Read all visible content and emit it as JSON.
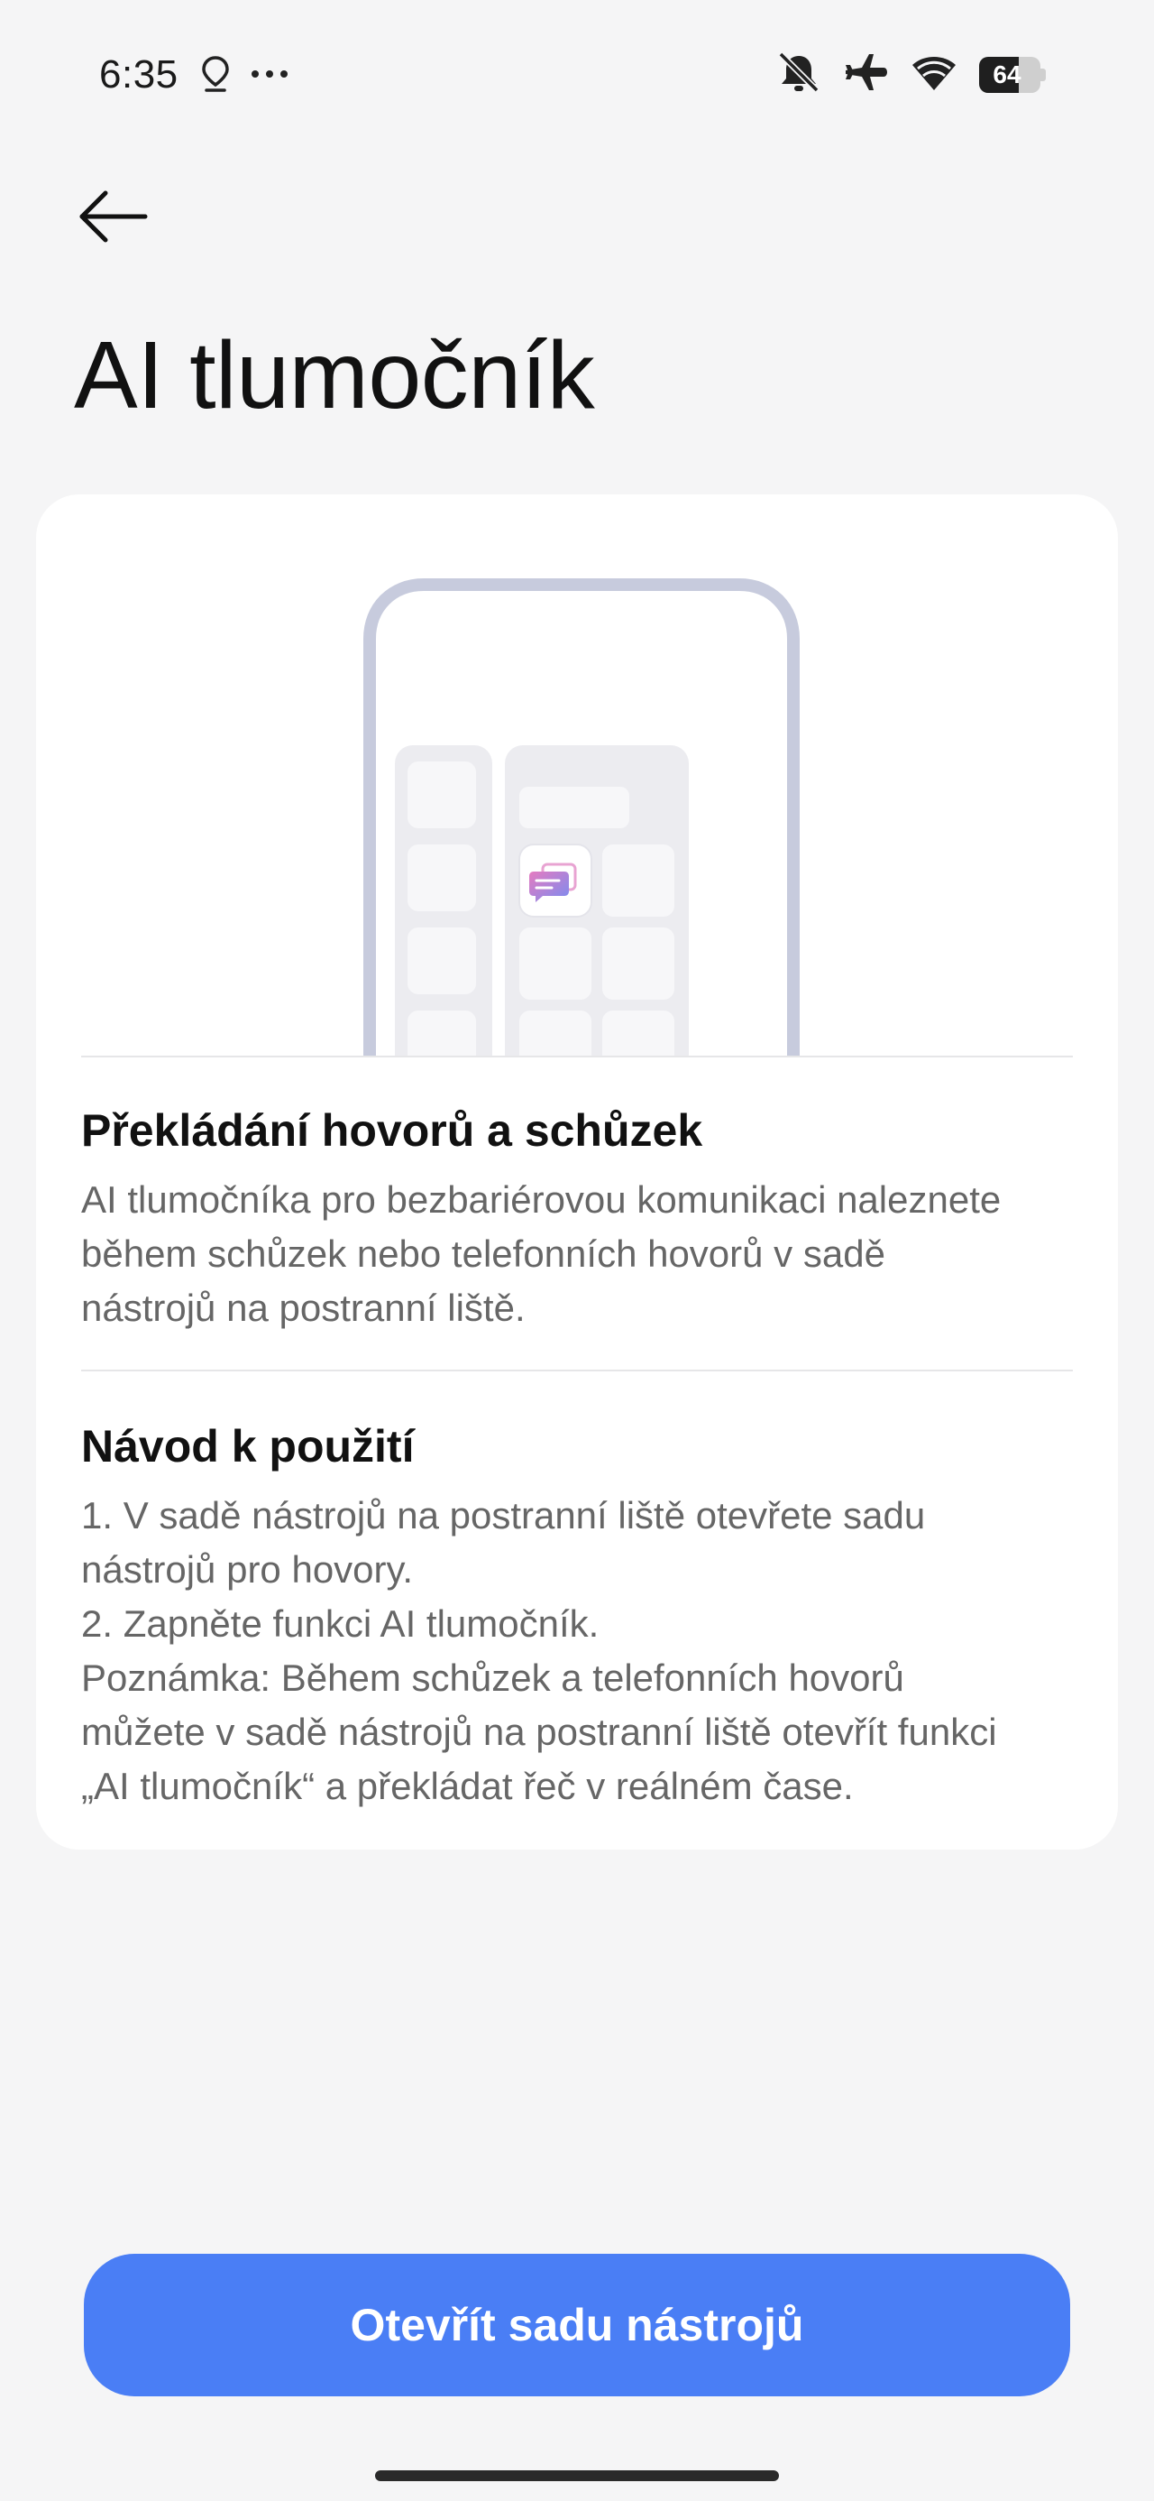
{
  "status_bar": {
    "time": "6:35",
    "battery_level": "64",
    "battery_fraction": 0.64,
    "icons": [
      "location-pin-icon",
      "more-dots-icon",
      "mute-bell-icon",
      "airplane-icon",
      "wifi-icon",
      "battery-icon"
    ]
  },
  "header": {
    "back_icon": "back-arrow-icon",
    "title": "AI tlumočník"
  },
  "card": {
    "illustration": {
      "subject": "phone-with-sidebar-toolbox",
      "app_icon": "chat-translate-icon",
      "colors": {
        "frame": "#c7cbdd",
        "panel": "#ececf0",
        "tile": "#f7f7f9",
        "icon_accent_pink": "#e57bc0",
        "icon_accent_blue": "#7a8cf0"
      }
    },
    "section1": {
      "title": "Překládání hovorů a schůzek",
      "lines": [
        "AI tlumočníka pro bezbariérovou komunikaci naleznete",
        "během schůzek nebo telefonních hovorů v sadě",
        "nástrojů na postranní liště."
      ]
    },
    "section2": {
      "title": "Návod k použití",
      "lines": [
        "1. V sadě nástrojů na postranní liště otevřete sadu",
        "nástrojů pro hovory.",
        "2. Zapněte funkci AI tlumočník.",
        "Poznámka: Během schůzek a telefonních hovorů",
        "můžete v sadě nástrojů na postranní liště otevřít funkci",
        "„AI tlumočník“ a překládat řeč v reálném čase."
      ]
    }
  },
  "primary_button": {
    "label": "Otevřít sadu nástrojů",
    "color": "#4a7ef5"
  },
  "colors": {
    "background": "#f5f5f6",
    "card": "#ffffff",
    "title_text": "#111111",
    "body_text": "#666666"
  }
}
